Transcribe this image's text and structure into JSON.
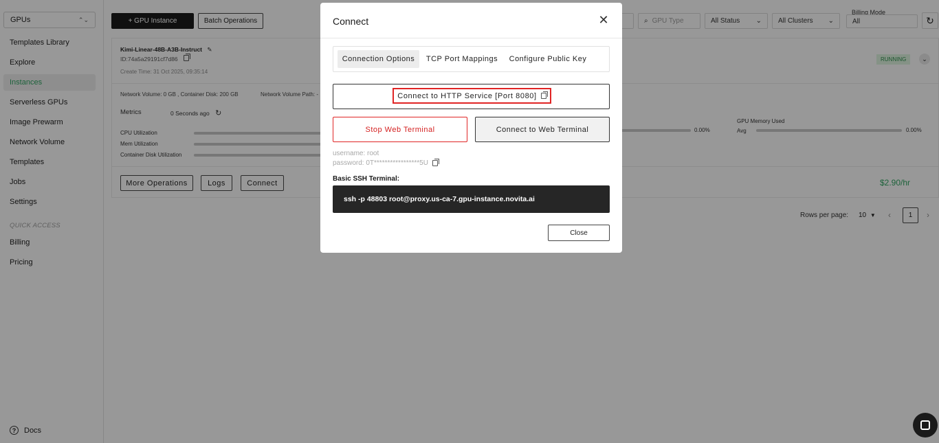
{
  "sidebar": {
    "selector": "GPUs",
    "items": [
      {
        "label": "Templates Library"
      },
      {
        "label": "Explore"
      },
      {
        "label": "Instances",
        "active": true
      },
      {
        "label": "Serverless GPUs"
      },
      {
        "label": "Image Prewarm"
      },
      {
        "label": "Network Volume"
      },
      {
        "label": "Templates"
      },
      {
        "label": "Jobs"
      },
      {
        "label": "Settings"
      }
    ],
    "quick_access_label": "QUICK ACCESS",
    "quick_items": [
      {
        "label": "Billing"
      },
      {
        "label": "Pricing"
      }
    ],
    "docs_label": "Docs"
  },
  "toolbar": {
    "add_gpu_label": "+ GPU Instance",
    "batch_label": "Batch Operations",
    "gpu_type_placeholder": "GPU Type",
    "status_filter": "All Status",
    "cluster_filter": "All Clusters",
    "billing_mode_label": "Billing Mode",
    "billing_mode_value": "All"
  },
  "instance": {
    "name": "Kimi-Linear-48B-A3B-Instruct",
    "id": "ID:74a5a29191cf7d86",
    "create_time": "Create Time: 31 Oct 2025, 09:35:14",
    "status": "RUNNING",
    "volume_info": "Network Volume: 0 GB , Container Disk: 200 GB",
    "volume_path": "Network Volume Path: -",
    "metrics_label": "Metrics",
    "metrics_updated": "0 Seconds ago",
    "cpu_label": "CPU Utilization",
    "mem_label": "Mem Utilization",
    "disk_label": "Container Disk Utilization",
    "gpu_pct": "0.00%",
    "gpu_mem_label": "GPU Memory Used",
    "gpu_mem_avg": "Avg",
    "gpu_mem_pct": "0.00%",
    "more_ops_label": "More Operations",
    "logs_label": "Logs",
    "connect_label": "Connect",
    "price": "$2.90/hr"
  },
  "pagination": {
    "rows_label": "Rows per page:",
    "rows_value": "10",
    "page": "1"
  },
  "modal": {
    "title": "Connect",
    "tabs": [
      {
        "label": "Connection Options",
        "active": true
      },
      {
        "label": "TCP Port Mappings"
      },
      {
        "label": "Configure Public Key"
      }
    ],
    "http_service_label": "Connect to HTTP Service [Port 8080]",
    "stop_terminal_label": "Stop Web Terminal",
    "web_terminal_label": "Connect to Web Terminal",
    "username": "username: root",
    "password": "password: 0T*****************5U",
    "ssh_label": "Basic SSH Terminal:",
    "ssh_command": "ssh -p 48803 root@proxy.us-ca-7.gpu-instance.novita.ai",
    "close_label": "Close"
  },
  "colors": {
    "accent_green": "#2e9e5e",
    "danger_red": "#e02424",
    "dark": "#1a1a1a"
  }
}
